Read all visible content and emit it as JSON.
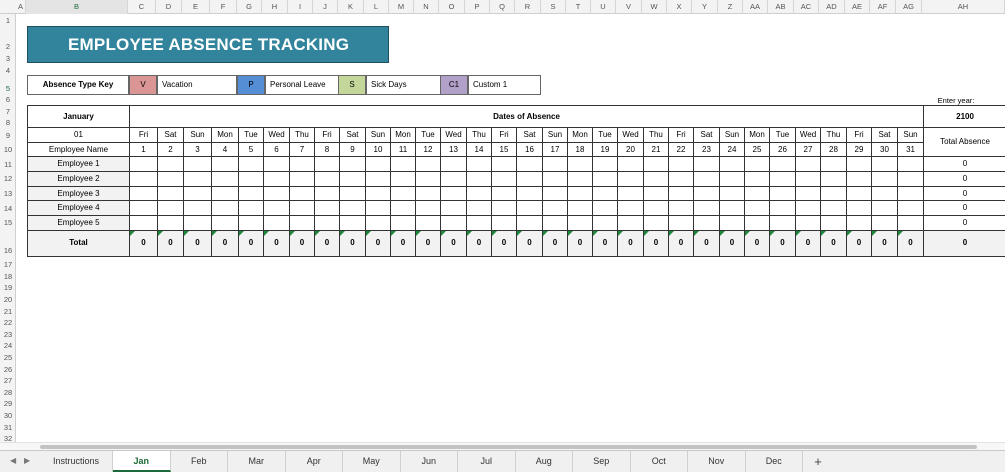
{
  "columns": [
    "A",
    "B",
    "C",
    "D",
    "E",
    "F",
    "G",
    "H",
    "I",
    "J",
    "K",
    "L",
    "M",
    "N",
    "O",
    "P",
    "Q",
    "R",
    "S",
    "T",
    "U",
    "V",
    "W",
    "X",
    "Y",
    "Z",
    "AA",
    "AB",
    "AC",
    "AD",
    "AE",
    "AF",
    "AG",
    "AH"
  ],
  "rows": [
    "1",
    "2",
    "3",
    "4",
    "5",
    "6",
    "7",
    "8",
    "9",
    "10",
    "11",
    "12",
    "13",
    "14",
    "15",
    "16",
    "17",
    "18",
    "19",
    "20",
    "21",
    "22",
    "23",
    "24",
    "25",
    "26",
    "27",
    "28",
    "29",
    "30",
    "31",
    "32"
  ],
  "title": "EMPLOYEE ABSENCE TRACKING",
  "key": {
    "label": "Absence Type Key",
    "items": [
      {
        "code": "V",
        "text": "Vacation",
        "color": "#da9694"
      },
      {
        "code": "P",
        "text": "Personal Leave",
        "color": "#558ed5"
      },
      {
        "code": "S",
        "text": "Sick Days",
        "color": "#c4d79b"
      },
      {
        "code": "C1",
        "text": "Custom 1",
        "color": "#b1a0c7"
      }
    ]
  },
  "enter_year_label": "Enter year:",
  "year": "2100",
  "month": "January",
  "month_num": "01",
  "dates_header": "Dates of Absence",
  "employee_name_header": "Employee Name",
  "total_absence_header": "Total Absence",
  "weekdays": [
    "Fri",
    "Sat",
    "Sun",
    "Mon",
    "Tue",
    "Wed",
    "Thu",
    "Fri",
    "Sat",
    "Sun",
    "Mon",
    "Tue",
    "Wed",
    "Thu",
    "Fri",
    "Sat",
    "Sun",
    "Mon",
    "Tue",
    "Wed",
    "Thu",
    "Fri",
    "Sat",
    "Sun",
    "Mon",
    "Tue",
    "Wed",
    "Thu",
    "Fri",
    "Sat",
    "Sun"
  ],
  "days": [
    "1",
    "2",
    "3",
    "4",
    "5",
    "6",
    "7",
    "8",
    "9",
    "10",
    "11",
    "12",
    "13",
    "14",
    "15",
    "16",
    "17",
    "18",
    "19",
    "20",
    "21",
    "22",
    "23",
    "24",
    "25",
    "26",
    "27",
    "28",
    "29",
    "30",
    "31"
  ],
  "employees": [
    {
      "name": "Employee 1",
      "total": "0"
    },
    {
      "name": "Employee 2",
      "total": "0"
    },
    {
      "name": "Employee 3",
      "total": "0"
    },
    {
      "name": "Employee 4",
      "total": "0"
    },
    {
      "name": "Employee 5",
      "total": "0"
    }
  ],
  "total_label": "Total",
  "day_totals": [
    "0",
    "0",
    "0",
    "0",
    "0",
    "0",
    "0",
    "0",
    "0",
    "0",
    "0",
    "0",
    "0",
    "0",
    "0",
    "0",
    "0",
    "0",
    "0",
    "0",
    "0",
    "0",
    "0",
    "0",
    "0",
    "0",
    "0",
    "0",
    "0",
    "0",
    "0"
  ],
  "grand_total": "0",
  "sheet_tabs": [
    "Instructions",
    "Jan",
    "Feb",
    "Mar",
    "Apr",
    "May",
    "Jun",
    "Jul",
    "Aug",
    "Sep",
    "Oct",
    "Nov",
    "Dec"
  ],
  "active_tab": "Jan",
  "add_sheet_label": "+"
}
